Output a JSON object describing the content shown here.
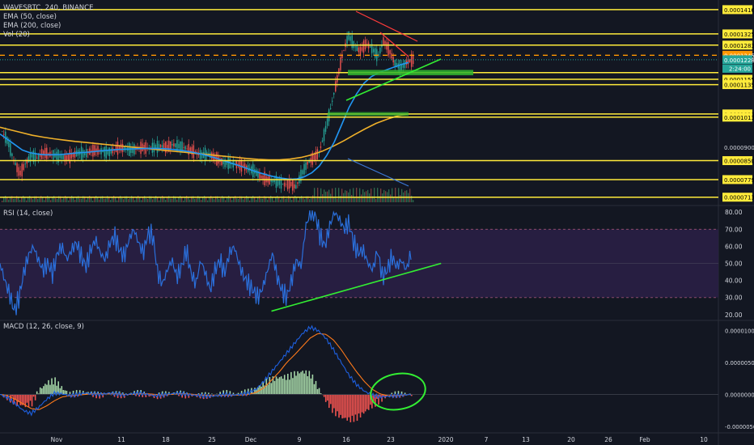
{
  "symbol_line": "WAVESBTC, 240, BINANCE",
  "indicators": [
    "EMA (50, close)",
    "EMA (200, close)",
    "Vol (20)"
  ],
  "rsi_label": "RSI (14, close)",
  "macd_label": "MACD (12, 26, close, 9)",
  "colors": {
    "background": "#131722",
    "support_resistance": "#ffeb3b",
    "ema50": "#2196f3",
    "ema200": "#f0b12a",
    "trendline_up": "#33ee33",
    "trendline_down_red": "#ff3b3b",
    "trendline_down_blue": "#3c78d8",
    "current_price_badge": "#26a69a",
    "last_close_dashed": "#ff9800",
    "rsi_line": "#2a6fdb",
    "macd_line": "#1e60e0",
    "signal_line": "#ff7a1a",
    "hist_up": "#a5d6a7",
    "hist_down": "#ef5350",
    "axis_text": "#d1d4dc"
  },
  "chart_data": [
    {
      "type": "line",
      "title": "WAVESBTC, 240, BINANCE",
      "ylim": [
        7e-05,
        0.000144
      ],
      "price_levels": [
        "0.0001416",
        "0.0001325",
        "0.0001283",
        "0.0001245",
        "0.0001228",
        "0.0001155",
        "0.0001135",
        "0.0001025",
        "0.0001013",
        "0.0000900",
        "0.0000850",
        "0.0000779",
        "0.0000713"
      ],
      "horizontal_lines": [
        0.0001416,
        0.0001325,
        0.0001283,
        0.000118,
        0.0001155,
        0.0001135,
        0.0001025,
        0.0001013,
        8.5e-05,
        7.79e-05,
        7.13e-05
      ],
      "last_close_level": 0.0001245,
      "current_price": "0.0001228",
      "countdown": "2:24:00",
      "x_axis_labels": [
        "Nov",
        "11",
        "18",
        "25",
        "Dec",
        "9",
        "16",
        "23",
        "2020",
        "7",
        "13",
        "20",
        "26",
        "Feb",
        "10"
      ],
      "price_close": [
        9.6e-05,
        9.2e-05,
        8.5e-05,
        8e-05,
        8.4e-05,
        8.7e-05,
        8.6e-05,
        8.8e-05,
        8.75e-05,
        8.7e-05,
        8.65e-05,
        8.6e-05,
        8.7e-05,
        8.8e-05,
        8.75e-05,
        8.85e-05,
        8.9e-05,
        8.85e-05,
        8.8e-05,
        8.9e-05,
        9e-05,
        8.95e-05,
        8.9e-05,
        8.95e-05,
        9e-05,
        8.95e-05,
        9e-05,
        9.05e-05,
        9e-05,
        9.1e-05,
        9.05e-05,
        9e-05,
        8.9e-05,
        8.8e-05,
        8.7e-05,
        8.75e-05,
        8.65e-05,
        8.5e-05,
        8.4e-05,
        8.4e-05,
        8.35e-05,
        8.3e-05,
        8.2e-05,
        8.1e-05,
        7.9e-05,
        7.8e-05,
        7.75e-05,
        7.7e-05,
        7.6e-05,
        7.65e-05,
        7.5e-05,
        8e-05,
        8.4e-05,
        8.6e-05,
        8.8e-05,
        9.6e-05,
        0.000105,
        0.000115,
        0.000125,
        0.000132,
        0.000128,
        0.000126,
        0.000129,
        0.000127,
        0.000124,
        0.00013,
        0.000126,
        0.000121,
        0.00012,
        0.000122,
        0.0001228
      ],
      "ema50": [
        9.5e-05,
        9.3e-05,
        9.1e-05,
        8.9e-05,
        8.8e-05,
        8.75e-05,
        8.72e-05,
        8.72e-05,
        8.73e-05,
        8.75e-05,
        8.78e-05,
        8.8e-05,
        8.82e-05,
        8.85e-05,
        8.88e-05,
        8.9e-05,
        8.92e-05,
        8.93e-05,
        8.94e-05,
        8.95e-05,
        8.96e-05,
        8.96e-05,
        8.95e-05,
        8.93e-05,
        8.9e-05,
        8.86e-05,
        8.81e-05,
        8.75e-05,
        8.68e-05,
        8.6e-05,
        8.51e-05,
        8.42e-05,
        8.33e-05,
        8.23e-05,
        8.13e-05,
        8.04e-05,
        7.96e-05,
        7.89e-05,
        7.84e-05,
        7.8e-05,
        7.82e-05,
        7.9e-05,
        8.05e-05,
        8.3e-05,
        8.7e-05,
        9.2e-05,
        9.85e-05,
        0.000105,
        0.00011,
        0.000114,
        0.0001165,
        0.000118,
        0.000119,
        0.00012,
        0.000121,
        0.0001218
      ],
      "ema200": [
        9.75e-05,
        9.65e-05,
        9.55e-05,
        9.45e-05,
        9.38e-05,
        9.32e-05,
        9.27e-05,
        9.22e-05,
        9.18e-05,
        9.14e-05,
        9.1e-05,
        9.06e-05,
        9.02e-05,
        8.98e-05,
        8.94e-05,
        8.9e-05,
        8.86e-05,
        8.82e-05,
        8.78e-05,
        8.74e-05,
        8.7e-05,
        8.66e-05,
        8.62e-05,
        8.58e-05,
        8.55e-05,
        8.53e-05,
        8.53e-05,
        8.56e-05,
        8.62e-05,
        8.72e-05,
        8.86e-05,
        9.04e-05,
        9.25e-05,
        9.48e-05,
        9.7e-05,
        9.9e-05,
        0.0001005,
        0.0001018,
        0.0001025
      ]
    },
    {
      "type": "line",
      "title": "RSI (14, close)",
      "ylim": [
        18,
        82
      ],
      "y_ticks": [
        "80.00",
        "70.00",
        "60.00",
        "50.00",
        "40.00",
        "30.00",
        "20.00"
      ],
      "overbought": 70,
      "oversold": 30,
      "values": [
        50,
        40,
        32,
        22,
        30,
        45,
        55,
        60,
        52,
        46,
        50,
        44,
        56,
        60,
        52,
        58,
        62,
        54,
        48,
        58,
        64,
        56,
        52,
        62,
        66,
        58,
        54,
        64,
        70,
        62,
        56,
        68,
        66,
        44,
        38,
        46,
        52,
        42,
        48,
        58,
        44,
        38,
        52,
        44,
        34,
        46,
        52,
        44,
        56,
        60,
        50,
        42,
        38,
        34,
        30,
        36,
        46,
        56,
        42,
        34,
        30,
        40,
        52,
        48,
        72,
        80,
        78,
        66,
        60,
        72,
        80,
        76,
        70,
        74,
        62,
        56,
        58,
        50,
        46,
        58,
        42,
        46,
        54,
        48,
        52,
        46,
        56
      ],
      "trendline": [
        [
          0.36,
          22
        ],
        [
          0.585,
          50
        ]
      ]
    },
    {
      "type": "line",
      "title": "MACD (12, 26, close, 9)",
      "ylim": [
        -5.5e-06,
        1.08e-05
      ],
      "y_ticks": [
        "0.0000100",
        "0.0000050",
        "0.0000000",
        "-0.0000050"
      ],
      "macd": [
        0,
        -5e-07,
        -1.5e-06,
        -2.5e-06,
        -3e-06,
        -2e-06,
        -8e-07,
        2e-07,
        1e-07,
        -2e-07,
        0.0,
        2e-07,
        1e-07,
        0.0,
        2e-07,
        1e-07,
        -1e-07,
        1e-07,
        2e-07,
        0.0,
        -2e-07,
        -1e-07,
        1e-07,
        2e-07,
        0.0,
        -1e-07,
        -2e-07,
        -3e-07,
        -2e-07,
        0.0,
        -1e-07,
        0.0,
        2e-07,
        8e-07,
        2e-06,
        3.5e-06,
        5e-06,
        6.5e-06,
        8e-06,
        9.5e-06,
        1.05e-05,
        1e-05,
        8.8e-06,
        7e-06,
        5e-06,
        3e-06,
        1.5e-06,
        5e-07,
        -1e-07,
        -4e-07,
        -3e-07,
        -2e-07,
        -1e-07,
        0.0
      ],
      "signal": [
        0,
        -2e-07,
        -8e-07,
        -1.5e-06,
        -2.2e-06,
        -2.4e-06,
        -1.8e-06,
        -1e-06,
        -4e-07,
        -2e-07,
        -1e-07,
        0.0,
        1e-07,
        1e-07,
        1e-07,
        1e-07,
        0.0,
        0.0,
        1e-07,
        1e-07,
        0.0,
        -1e-07,
        0.0,
        1e-07,
        1e-07,
        0.0,
        -1e-07,
        -2e-07,
        -2e-07,
        -1e-07,
        -1e-07,
        -1e-07,
        0.0,
        3e-07,
        1e-06,
        2.2e-06,
        3.5e-06,
        5e-06,
        6.2e-06,
        7.5e-06,
        8.8e-06,
        9.5e-06,
        9.4e-06,
        8.5e-06,
        7e-06,
        5.2e-06,
        3.5e-06,
        2e-06,
        8e-07,
        1e-07,
        -2e-07,
        -2e-07,
        -1e-07,
        0.0
      ]
    }
  ]
}
